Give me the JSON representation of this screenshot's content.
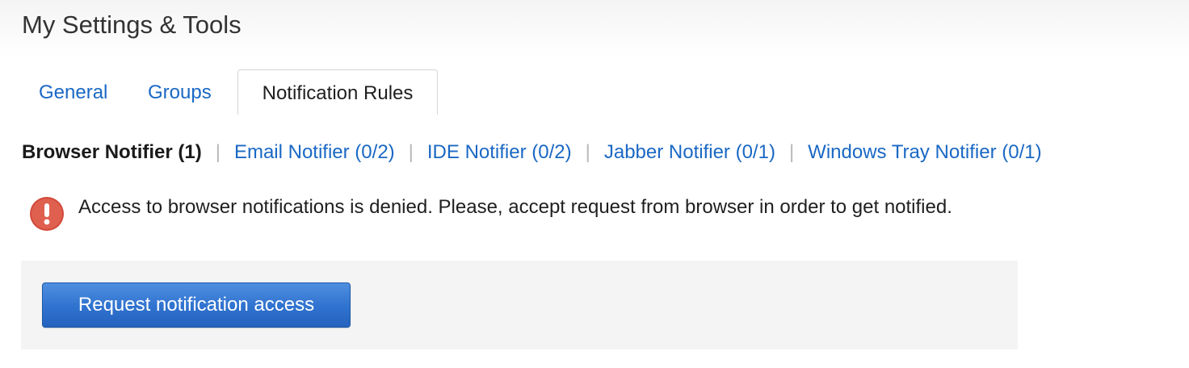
{
  "page": {
    "title": "My Settings & Tools"
  },
  "tabs": [
    {
      "label": "General",
      "active": false
    },
    {
      "label": "Groups",
      "active": false
    },
    {
      "label": "Notification Rules",
      "active": true
    }
  ],
  "notifiers": [
    {
      "label": "Browser Notifier (1)",
      "active": true
    },
    {
      "label": "Email Notifier (0/2)",
      "active": false
    },
    {
      "label": "IDE Notifier (0/2)",
      "active": false
    },
    {
      "label": "Jabber Notifier (0/1)",
      "active": false
    },
    {
      "label": "Windows Tray Notifier (0/1)",
      "active": false
    }
  ],
  "separator": "|",
  "alert": {
    "icon": "exclamation-icon",
    "icon_glyph": "!",
    "icon_color": "#e0604f",
    "message": "Access to browser notifications is denied. Please, accept request from browser in order to get notified."
  },
  "actions": {
    "request_label": "Request notification access"
  },
  "colors": {
    "link": "#1a68c4",
    "button": "#2f72cf",
    "panel_background": "#f4f4f4"
  }
}
